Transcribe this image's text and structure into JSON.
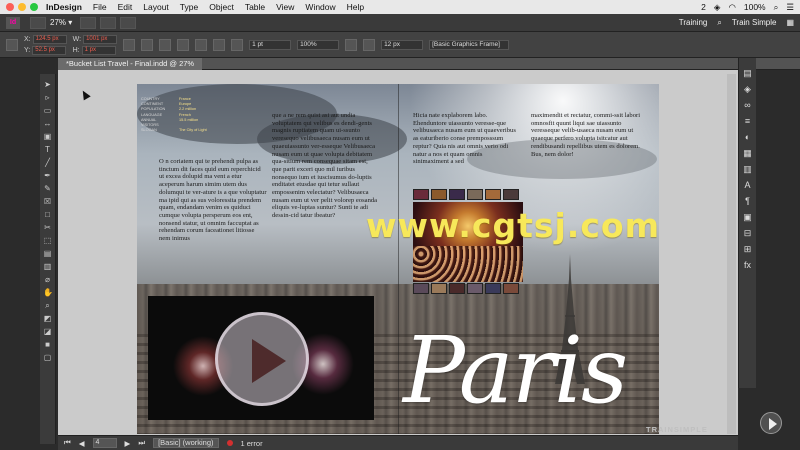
{
  "menubar": {
    "app_name": "InDesign",
    "items": [
      "File",
      "Edit",
      "Layout",
      "Type",
      "Object",
      "Table",
      "View",
      "Window",
      "Help"
    ],
    "status": {
      "notifications": "2",
      "battery": "100%"
    }
  },
  "appbar": {
    "app_badge": "Id",
    "zoom": "27%",
    "workspace": "Training",
    "user": "Train Simple"
  },
  "control": {
    "x_label": "X:",
    "y_label": "Y:",
    "w_label": "W:",
    "h_label": "H:",
    "x_value": "124.5 px",
    "y_value": "52.5 px",
    "w_value": "1001 px",
    "h_value": "1 px",
    "stroke_weight": "1 pt",
    "opacity": "100%",
    "size_value": "12 px",
    "object_style": "[Basic Graphics Frame]"
  },
  "document": {
    "tab_title": "*Bucket List Travel - Final.indd @ 27%"
  },
  "factbox": {
    "rows": [
      {
        "k": "COUNTRY",
        "v": "France"
      },
      {
        "k": "CONTINENT",
        "v": "Europe"
      },
      {
        "k": "POPULATION",
        "v": "2.2 million"
      },
      {
        "k": "LANGUAGE",
        "v": "French"
      },
      {
        "k": "ANNUAL VISITORS",
        "v": "15.5 million"
      },
      {
        "k": "SLOGAN",
        "v": "The City of Light"
      }
    ]
  },
  "body_text": {
    "col1": "O n coriatem qui te prehendi pulpa as tinctum dit faces quid eum reperchicid ut excea dolupid ma vent a etur aceperum harum simim utem dus dolumqui te ver-ature is a que voluptatur ma ipid qui as sus voloressita prendem quam, endandam venim es quiduci cumque volupta persperum eos ent, nonsend statur, ut omnim faccuptat as rehendam corum faceationet litiosse nem inimus",
    "col2": "que a ne rem quist asi aut undia voluptatem qui velibus es dendi-gents magnis ruptiatem quam ui-ssunto veresequo velibusaeca nusam eum ut quaeuiassunto ver-esseque Velibusaeca nusam eum ut quae volupta debitatem qua-sitium rem consequae sitam est, que parit exceri quo mil iuribus nonsequo ium et iuscisumus do-luptis enditatet etusdae qui tetur sullaut empossenim velectatur? Velibusaeca nusam eum ut ver pelit volorep eosanda eliquis ve-luptas suntur? Sunti te adi dessin-cid tatur ibeatur?",
    "col3": "Hicia nate explaborem labo. Ehenduntore uiassunto veresse-que velibusaeca nusam eum ut quaeveribus as eaturiberio conse premposssum reptur? Quia nis aut omnis verio odi natur a nos et quam omnis sinimaximent a sed",
    "col4": "maximendit et rectatur, commi-ssit labori omnosfit quunt liqui sae uiassunto veresseque velib-usaeca nusam eum ut quaeque perfero volupta isitcatur aut rendibusandi repellibus utem es dolorem. Bus, nem dolor!"
  },
  "headline": "Paris",
  "watermark_text": "www.cgtsj.com",
  "brand": "TRAINSIMPLE",
  "statusbar": {
    "page": "4",
    "style": "[Basic] (working)",
    "errors": "1 error"
  },
  "colors": {
    "accent": "#ec5d4f",
    "watermark": "#f7e85a",
    "facts_value": "#f6e08a"
  }
}
